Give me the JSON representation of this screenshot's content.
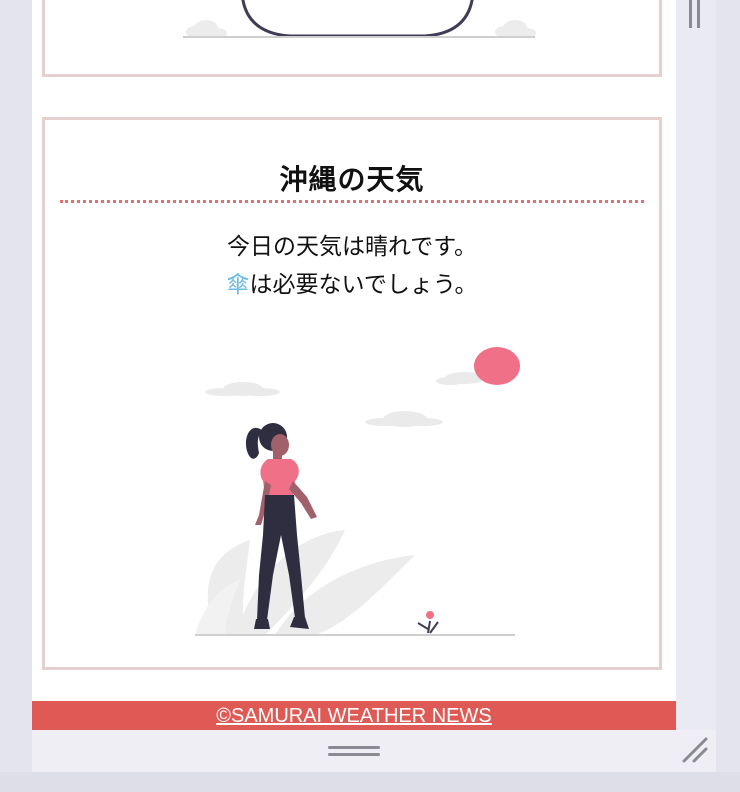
{
  "card": {
    "title": "沖縄の天気",
    "line1": "今日の天気は晴れです。",
    "umbrella": "傘",
    "line2_rest": "は必要ないでしょう。"
  },
  "footer": {
    "link": "©SAMURAI WEATHER NEWS"
  },
  "colors": {
    "accent": "#e05a55",
    "card_border": "#e5d0d0",
    "divider": "#e46f6f",
    "umbrella": "#6cbbe6",
    "sun": "#f07088"
  }
}
